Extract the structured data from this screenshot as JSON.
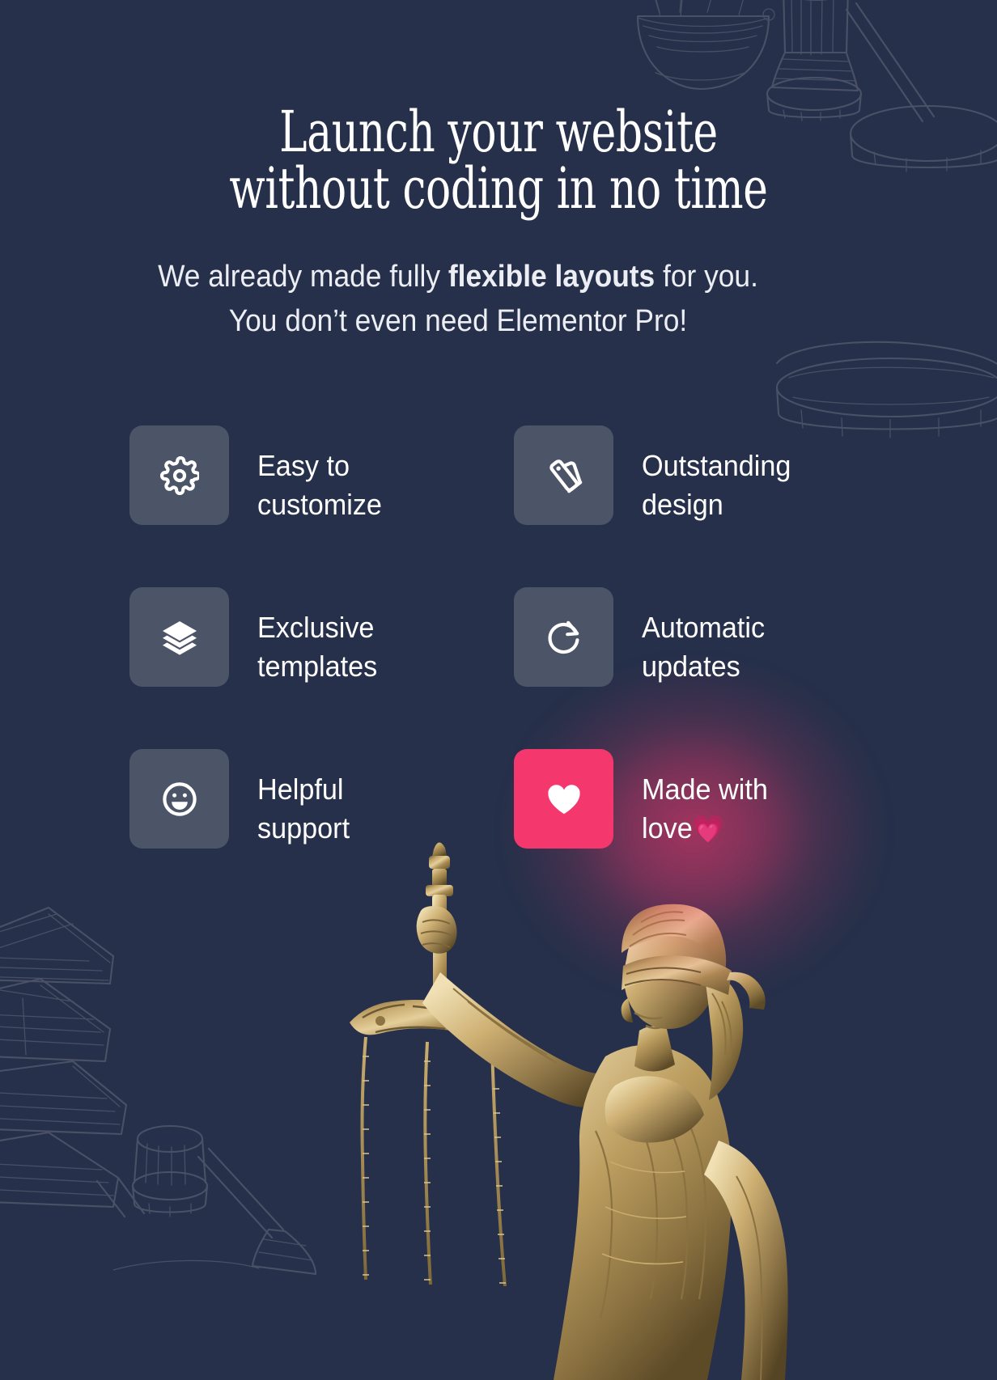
{
  "theme": {
    "background_color": "#26304a",
    "tile_color": "#4c5468",
    "accent_color": "#f4376d",
    "text_color": "#ffffff",
    "sketch_color": "#4a5167"
  },
  "hero": {
    "headline": "Launch your website\nwithout coding in no time",
    "subtitle_before": "We already made fully ",
    "subtitle_bold": "flexible layouts",
    "subtitle_after": " for you. You don’t even need Elementor Pro!"
  },
  "features": [
    {
      "icon": "gear-icon",
      "label": "Easy to\ncustomize",
      "accent": false
    },
    {
      "icon": "palette-icon",
      "label": "Outstanding\ndesign",
      "accent": false
    },
    {
      "icon": "layers-icon",
      "label": "Exclusive\ntemplates",
      "accent": false
    },
    {
      "icon": "refresh-icon",
      "label": "Automatic\nupdates",
      "accent": false
    },
    {
      "icon": "smiley-icon",
      "label": "Helpful\nsupport",
      "accent": false
    },
    {
      "icon": "heart-icon",
      "label": "Made with\nlove",
      "emoji": "💗",
      "accent": true
    }
  ],
  "decorations": [
    {
      "name": "scales-of-justice-sketch",
      "position": "top-right"
    },
    {
      "name": "gavel-sketch",
      "position": "top-right"
    },
    {
      "name": "gavel-block-sketch",
      "position": "right"
    },
    {
      "name": "book-stack-sketch",
      "position": "bottom-left"
    },
    {
      "name": "small-gavel-sketch",
      "position": "bottom-left"
    },
    {
      "name": "lady-justice-statue",
      "position": "bottom-center"
    }
  ]
}
